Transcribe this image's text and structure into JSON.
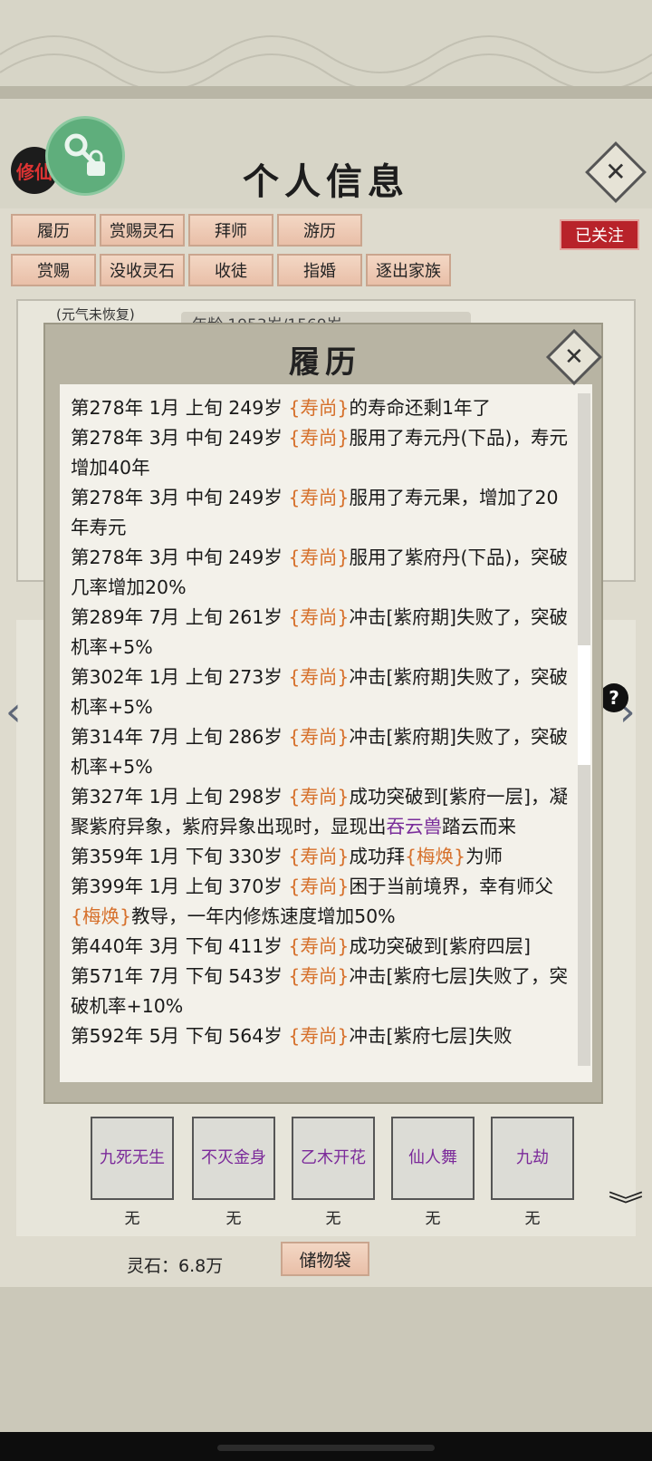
{
  "header": {
    "title": "个人信息",
    "logo_text": "修仙"
  },
  "tabs": [
    {
      "label": "履历"
    },
    {
      "label": "赏赐灵石"
    },
    {
      "label": "拜师"
    },
    {
      "label": "游历"
    },
    {
      "label": "赏赐"
    },
    {
      "label": "没收灵石"
    },
    {
      "label": "收徒"
    },
    {
      "label": "指婚"
    },
    {
      "label": "逐出家族"
    }
  ],
  "follow_label": "已关注",
  "status_hint": "(元气未恢复)",
  "background_info_row": "年龄 1953岁/1569岁",
  "dialog": {
    "title": "履历",
    "entries": [
      {
        "pre": "第278年 1月 上旬  249岁 ",
        "name": "{寿尚}",
        "post": "的寿命还剩1年了"
      },
      {
        "pre": "第278年 3月 中旬  249岁 ",
        "name": "{寿尚}",
        "post": "服用了寿元丹(下品)，寿元增加40年"
      },
      {
        "pre": "第278年 3月 中旬  249岁 ",
        "name": "{寿尚}",
        "post": "服用了寿元果，增加了20年寿元"
      },
      {
        "pre": "第278年 3月 中旬  249岁 ",
        "name": "{寿尚}",
        "post": "服用了紫府丹(下品)，突破几率增加20%"
      },
      {
        "pre": "第289年 7月 上旬  261岁 ",
        "name": "{寿尚}",
        "post": "冲击[紫府期]失败了，突破机率+5%"
      },
      {
        "pre": "第302年 1月 上旬  273岁 ",
        "name": "{寿尚}",
        "post": "冲击[紫府期]失败了，突破机率+5%"
      },
      {
        "pre": "第314年 7月 上旬  286岁 ",
        "name": "{寿尚}",
        "post": "冲击[紫府期]失败了，突破机率+5%"
      },
      {
        "pre": "第327年 1月 上旬  298岁  ",
        "name": "{寿尚}",
        "post": "成功突破到[紫府一层]，凝聚紫府异象，紫府异象出现时，显现出",
        "special": "吞云兽",
        "tail": "踏云而来"
      },
      {
        "pre": "第359年 1月 下旬  330岁 ",
        "name": "{寿尚}",
        "post": "成功拜",
        "name2": "{梅焕}",
        "tail": "为师"
      },
      {
        "pre": "第399年 1月 上旬 370岁 ",
        "name": "{寿尚}",
        "post": "困于当前境界，幸有师父",
        "name2": "{梅焕}",
        "tail": "教导，一年内修炼速度增加50%"
      },
      {
        "pre": "第440年 3月 下旬  411岁 ",
        "name": "{寿尚}",
        "post": "成功突破到[紫府四层]"
      },
      {
        "pre": "第571年 7月 下旬  543岁  ",
        "name": "{寿尚}",
        "post": "冲击[紫府七层]失败了，突破机率+10%"
      },
      {
        "pre": "第592年 5月 下旬  564岁  ",
        "name": "{寿尚}",
        "post": "冲击[紫府七层]失败"
      }
    ]
  },
  "skills": [
    {
      "name": "九死无生",
      "value": "无"
    },
    {
      "name": "不灭金身",
      "value": "无"
    },
    {
      "name": "乙木开花",
      "value": "无"
    },
    {
      "name": "仙人舞",
      "value": "无"
    },
    {
      "name": "九劫",
      "value": "无"
    }
  ],
  "spirit_stones": "灵石：6.8万",
  "bag_label": "储物袋",
  "colors": {
    "name_highlight": "#d6702b",
    "special_highlight": "#7a2d9a",
    "follow_red": "#b8232a",
    "tab_peach": "#eec9b4"
  }
}
